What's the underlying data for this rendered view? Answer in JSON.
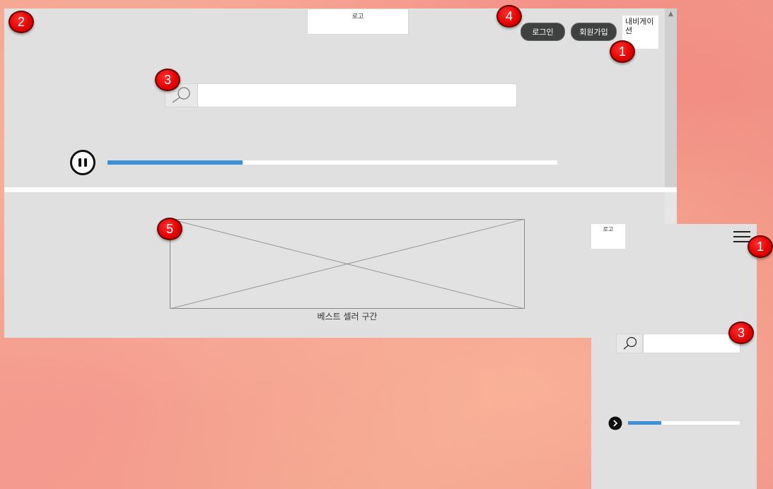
{
  "desktop": {
    "logo_text": "로고",
    "login_label": "로그인",
    "signup_label": "회원가입",
    "nav_label": "내비게이션",
    "search": {
      "value": "",
      "placeholder": ""
    },
    "player": {
      "state": "paused",
      "progress_percent": 30
    },
    "bestseller_label": "베스트 셀러 구간"
  },
  "mobile": {
    "logo_text": "로고",
    "search": {
      "value": "",
      "placeholder": ""
    },
    "player": {
      "state": "playing",
      "progress_percent": 30
    }
  },
  "annotations": [
    {
      "id": "badge-1-desktop-nav",
      "label": "1"
    },
    {
      "id": "badge-2-desktop",
      "label": "2"
    },
    {
      "id": "badge-3-desktop-search",
      "label": "3"
    },
    {
      "id": "badge-4-auth",
      "label": "4"
    },
    {
      "id": "badge-5-bestseller",
      "label": "5"
    },
    {
      "id": "badge-1-mobile-menu",
      "label": "1"
    },
    {
      "id": "badge-3-mobile-search",
      "label": "3"
    }
  ],
  "colors": {
    "accent": "#3d8fd8",
    "badge": "#e00000",
    "wireframe_bg": "#e0e0e0",
    "pill_bg": "#3f4040"
  }
}
